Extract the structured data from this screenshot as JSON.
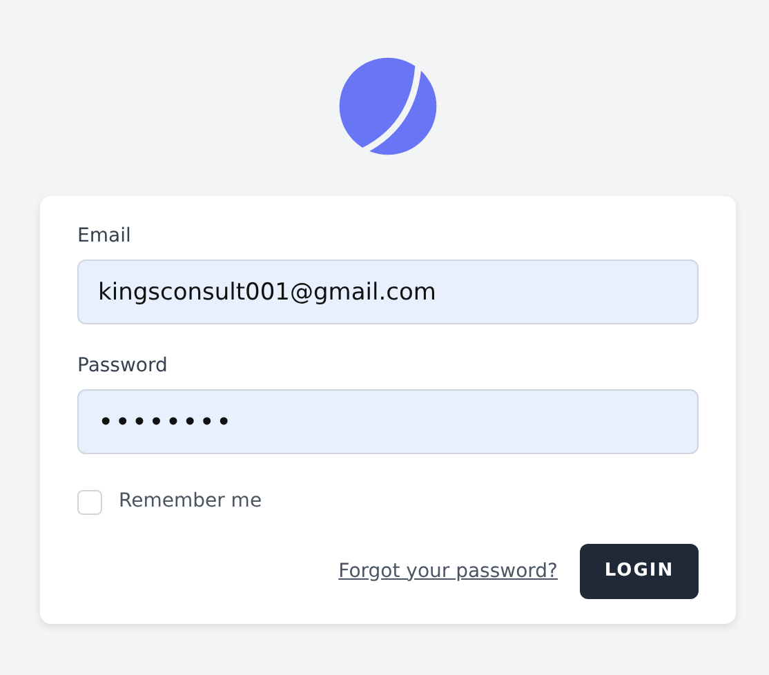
{
  "form": {
    "fields": [
      {
        "label": "Email",
        "value": "kingsconsult001@gmail.com",
        "kind": "text"
      },
      {
        "label": "Password",
        "value": "••••••••",
        "kind": "password"
      }
    ],
    "remember": {
      "label": "Remember me",
      "checked": false
    },
    "forgot_link": "Forgot your password?",
    "submit": "LOGIN"
  }
}
